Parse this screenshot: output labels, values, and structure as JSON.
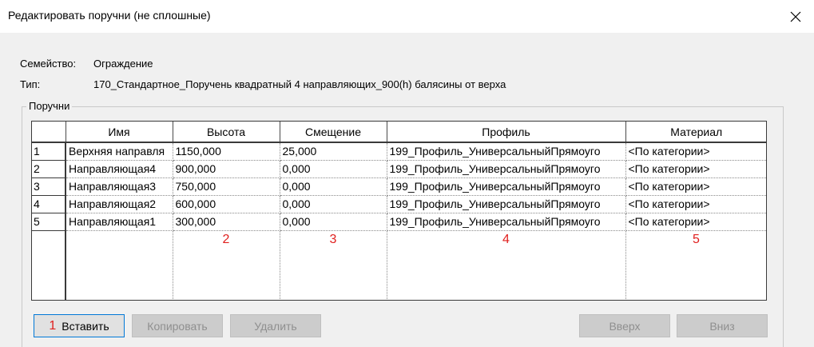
{
  "window": {
    "title": "Редактировать поручни (не сплошные)"
  },
  "info": {
    "family_label": "Семейство:",
    "family_value": "Ограждение",
    "type_label": "Тип:",
    "type_value": "170_Стандартное_Поручень квадратный 4 направляющих_900(h) балясины от верха"
  },
  "group": {
    "legend": "Поручни"
  },
  "table": {
    "columns": [
      "Имя",
      "Высота",
      "Смещение",
      "Профиль",
      "Материал"
    ],
    "rows": [
      {
        "n": "1",
        "name": "Верхняя направля",
        "height": "1150,000",
        "offset": "25,000",
        "profile": "199_Профиль_УниверсальныйПрямоуго",
        "material": "<По категории>"
      },
      {
        "n": "2",
        "name": "Направляющая4",
        "height": "900,000",
        "offset": "0,000",
        "profile": "199_Профиль_УниверсальныйПрямоуго",
        "material": "<По категории>"
      },
      {
        "n": "3",
        "name": "Направляющая3",
        "height": "750,000",
        "offset": "0,000",
        "profile": "199_Профиль_УниверсальныйПрямоуго",
        "material": "<По категории>"
      },
      {
        "n": "4",
        "name": "Направляющая2",
        "height": "600,000",
        "offset": "0,000",
        "profile": "199_Профиль_УниверсальныйПрямоуго",
        "material": "<По категории>"
      },
      {
        "n": "5",
        "name": "Направляющая1",
        "height": "300,000",
        "offset": "0,000",
        "profile": "199_Профиль_УниверсальныйПрямоуго",
        "material": "<По категории>"
      }
    ],
    "markers": [
      "2",
      "3",
      "4",
      "5"
    ]
  },
  "buttons": {
    "insert_marker": "1",
    "insert": "Вставить",
    "copy": "Копировать",
    "delete": "Удалить",
    "up": "Вверх",
    "down": "Вниз"
  },
  "colors": {
    "marker": "#e0201e",
    "focus_border": "#0078d7"
  },
  "icons": {
    "close": "close-icon"
  }
}
